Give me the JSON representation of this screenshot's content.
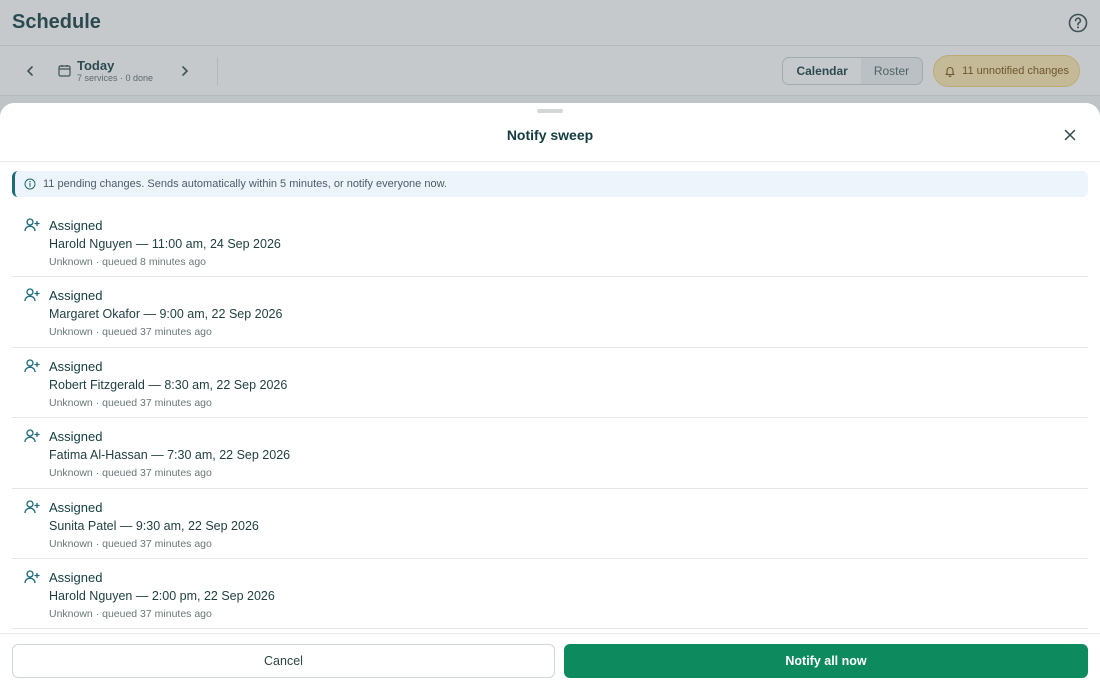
{
  "app": {
    "title": "Schedule",
    "date_title": "Today",
    "date_sub": "7 services · 0 done",
    "view_tabs": [
      {
        "label": "Calendar",
        "active": true
      },
      {
        "label": "Roster",
        "active": false
      }
    ],
    "notif_label": "11 unnotified changes"
  },
  "sheet": {
    "title": "Notify sweep",
    "banner": "11 pending changes. Sends automatically within 5 minutes, or notify everyone now.",
    "items": [
      {
        "kind": "Assigned",
        "detail": "Harold Nguyen — 11:00 am, 24 Sep 2026",
        "meta": "Unknown · queued 8 minutes ago"
      },
      {
        "kind": "Assigned",
        "detail": "Margaret Okafor — 9:00 am, 22 Sep 2026",
        "meta": "Unknown · queued 37 minutes ago"
      },
      {
        "kind": "Assigned",
        "detail": "Robert Fitzgerald — 8:30 am, 22 Sep 2026",
        "meta": "Unknown · queued 37 minutes ago"
      },
      {
        "kind": "Assigned",
        "detail": "Fatima Al-Hassan — 7:30 am, 22 Sep 2026",
        "meta": "Unknown · queued 37 minutes ago"
      },
      {
        "kind": "Assigned",
        "detail": "Sunita Patel — 9:30 am, 22 Sep 2026",
        "meta": "Unknown · queued 37 minutes ago"
      },
      {
        "kind": "Assigned",
        "detail": "Harold Nguyen — 2:00 pm, 22 Sep 2026",
        "meta": "Unknown · queued 37 minutes ago"
      }
    ],
    "cancel_label": "Cancel",
    "notify_label": "Notify all now"
  },
  "colors": {
    "accent": "#0e8a5f",
    "brand": "#123c40",
    "warning_bg": "#fde9b0"
  },
  "icons": {
    "item": "user-plus-icon",
    "info": "info-icon",
    "close": "close-icon",
    "calendar": "calendar-icon",
    "bell": "bell-icon",
    "help": "help-icon"
  }
}
